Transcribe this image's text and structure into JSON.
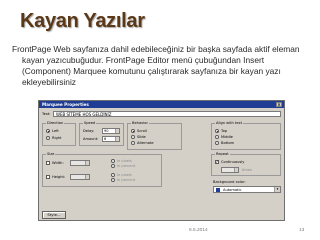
{
  "slide": {
    "title": "Kayan Yazılar",
    "body": "FrontPage Web sayfanıza dahil edebileceğiniz bir başka sayfada aktif eleman kayan yazıcubuğudur. FrontPage Editor menü çubuğundan Insert (Component) Marquee komutunu çalıştırarak sayfanıza bir kayan yazı ekleyebilirsiniz",
    "footer_date": "6.5.2014",
    "page_number": "13"
  },
  "dialog": {
    "title": "Marquee Properties",
    "close_label": "×",
    "text_label": "Text:",
    "text_value": "WEB SİTEME HOŞ GELDİNİZ",
    "direction": {
      "title": "Direction",
      "options": [
        "Left",
        "Right"
      ],
      "selected": "Left"
    },
    "speed": {
      "title": "Speed",
      "delay_label": "Delay:",
      "delay_value": "90",
      "amount_label": "Amount:",
      "amount_value": "6"
    },
    "behavior": {
      "title": "Behavior",
      "options": [
        "Scroll",
        "Slide",
        "Alternate"
      ],
      "selected": "Scroll"
    },
    "align": {
      "title": "Align with text",
      "options": [
        "Top",
        "Middle",
        "Bottom"
      ],
      "selected": "Top"
    },
    "size": {
      "title": "Size",
      "width_label": "Width:",
      "height_label": "Height:",
      "unit_options": [
        "in pixels",
        "in percent"
      ]
    },
    "repeat": {
      "title": "Repeat",
      "continuously_label": "Continuously",
      "times_label": "times"
    },
    "background": {
      "title": "Background color:",
      "value": "Automatic"
    },
    "style_button": "Style...",
    "ok_button": "OK",
    "cancel_button": "Cancel"
  },
  "colors": {
    "title_text": "#5a3818",
    "dialog_titlebar": "#1f3d94",
    "dialog_face": "#d4d0c8"
  }
}
